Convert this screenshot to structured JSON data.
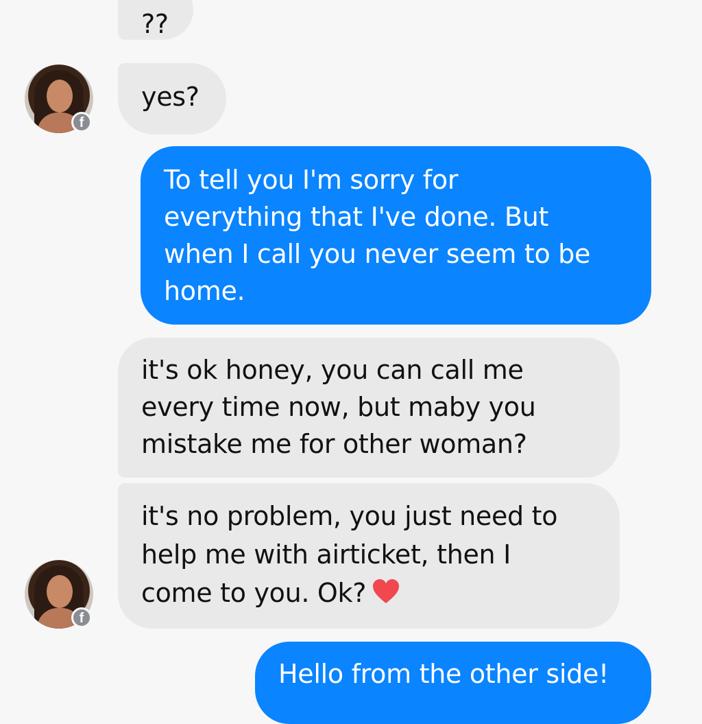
{
  "conversation": {
    "messages": [
      {
        "direction": "incoming",
        "text": "??"
      },
      {
        "direction": "incoming",
        "text": "yes?"
      },
      {
        "direction": "outgoing",
        "text": "To tell you I'm sorry for\neverything that I've done. But\nwhen I call you never seem to be\nhome."
      },
      {
        "direction": "incoming",
        "text": "it's ok honey, you can call me\nevery time now, but maby you\nmistake me for other woman?"
      },
      {
        "direction": "incoming",
        "text": "it's no problem, you just need to\nhelp me with airticket, then I\ncome to you. Ok?",
        "emoji": "heart-icon"
      },
      {
        "direction": "outgoing",
        "text": "Hello from the other side!"
      }
    ],
    "badge_glyph": "f"
  },
  "colors": {
    "outgoing_bubble": "#0a84ff",
    "incoming_bubble": "#e9e9e9",
    "background": "#f7f7f7",
    "heart": "#f0484e",
    "badge": "#8a8d91"
  }
}
